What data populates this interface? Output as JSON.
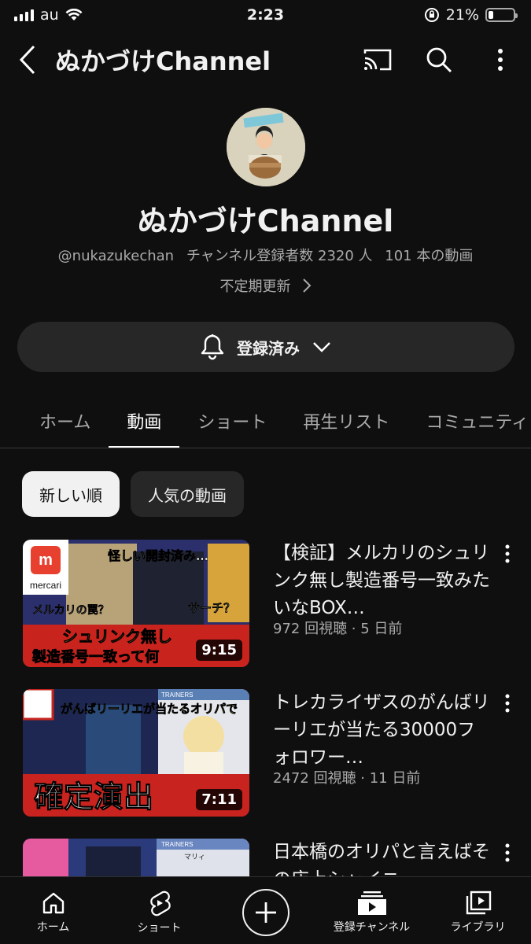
{
  "status_bar": {
    "carrier": "au",
    "time": "2:23",
    "battery": "21%",
    "battery_level": 0.21
  },
  "app_bar": {
    "title": "ぬかづけChannel"
  },
  "channel": {
    "name": "ぬかづけChannel",
    "handle": "@nukazukechan",
    "subscribers": "チャンネル登録者数 2320 人",
    "video_count": "101 本の動画",
    "description": "不定期更新",
    "subscribe_label": "登録済み"
  },
  "tabs": [
    {
      "label": "ホーム"
    },
    {
      "label": "動画"
    },
    {
      "label": "ショート"
    },
    {
      "label": "再生リスト"
    },
    {
      "label": "コミュニティ"
    }
  ],
  "chips": [
    {
      "label": "新しい順"
    },
    {
      "label": "人気の動画"
    }
  ],
  "videos": [
    {
      "title": "【検証】メルカリのシュリンク無し製造番号一致みたいなBOX…",
      "meta": "972 回視聴 · 5 日前",
      "duration": "9:15",
      "thumb_brand": "mercari",
      "thumb_text_1": "怪しい開封済み…",
      "thumb_text_2": "メルカリの罠？",
      "thumb_text_3": "サーチ？",
      "thumb_text_4": "シュリンク無し",
      "thumb_text_5": "製造番号一致って何"
    },
    {
      "title": "トレカライザスのがんばリーリエが当たる30000フォロワー…",
      "meta": "2472 回視聴 · 11 日前",
      "duration": "7:11",
      "thumb_text_1": "がんばリーリエが当たるオリパで",
      "thumb_text_2": "確定演出",
      "thumb_text_3": "TRAINERS"
    },
    {
      "title": "日本橋のオリパと言えばその店上シャイニ…",
      "thumb_text_1": "TRAINERS",
      "thumb_text_2": "マリィ"
    }
  ],
  "bottom_nav": [
    {
      "label": "ホーム"
    },
    {
      "label": "ショート"
    },
    {
      "label": ""
    },
    {
      "label": "登録チャンネル"
    },
    {
      "label": "ライブラリ"
    }
  ],
  "colors": {
    "background": "#0f0f0f",
    "surface": "#272727",
    "text_primary": "#f1f1f1",
    "text_secondary": "#aaaaaa"
  }
}
